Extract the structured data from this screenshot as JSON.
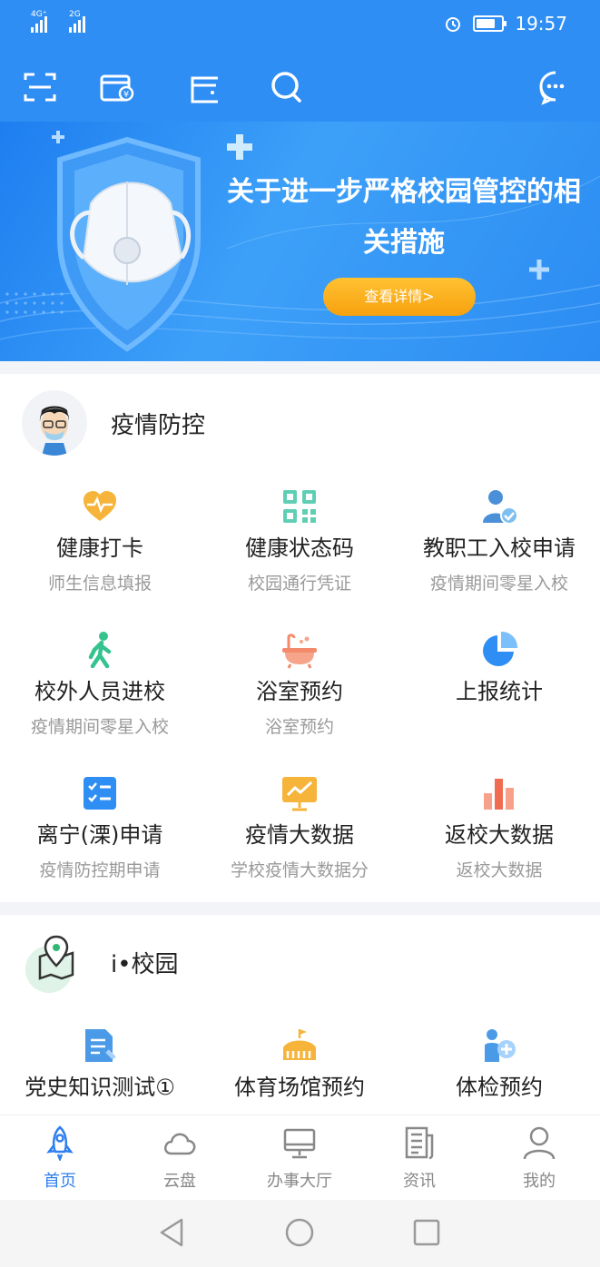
{
  "status": {
    "signal1": "4G⁺",
    "signal2": "2G",
    "time": "19:57",
    "battery_level": 0.75
  },
  "toolbar": {
    "icons": [
      "scan-icon",
      "wallet-icon",
      "card-icon",
      "search-icon",
      "message-icon"
    ]
  },
  "banner": {
    "title": "关于进一步严格校园管控的相关措施",
    "button": "查看详情>"
  },
  "epidemic": {
    "title": "疫情防控",
    "items": [
      {
        "label": "健康打卡",
        "sub": "师生信息填报",
        "icon": "heart-pulse-icon"
      },
      {
        "label": "健康状态码",
        "sub": "校园通行凭证",
        "icon": "qr-code-icon"
      },
      {
        "label": "教职工入校申请",
        "sub": "疫情期间零星入校",
        "icon": "staff-check-icon"
      },
      {
        "label": "校外人员进校",
        "sub": "疫情期间零星入校",
        "icon": "walking-person-icon"
      },
      {
        "label": "浴室预约",
        "sub": "浴室预约",
        "icon": "bathtub-icon"
      },
      {
        "label": "上报统计",
        "sub": "",
        "icon": "pie-chart-icon"
      },
      {
        "label": "离宁(溧)申请",
        "sub": "疫情防控期申请",
        "icon": "checklist-icon"
      },
      {
        "label": "疫情大数据",
        "sub": "学校疫情大数据分",
        "icon": "trend-board-icon"
      },
      {
        "label": "返校大数据",
        "sub": "返校大数据",
        "icon": "bar-chart-icon"
      }
    ]
  },
  "campus": {
    "title": "i•校园",
    "items": [
      {
        "label": "党史知识测试①",
        "icon": "document-edit-icon"
      },
      {
        "label": "体育场馆预约",
        "icon": "stadium-icon"
      },
      {
        "label": "体检预约",
        "icon": "medical-person-icon"
      }
    ]
  },
  "tabs": [
    {
      "label": "首页",
      "icon": "rocket-icon",
      "active": true
    },
    {
      "label": "云盘",
      "icon": "cloud-icon",
      "active": false
    },
    {
      "label": "办事大厅",
      "icon": "monitor-icon",
      "active": false
    },
    {
      "label": "资讯",
      "icon": "news-icon",
      "active": false
    },
    {
      "label": "我的",
      "icon": "user-icon",
      "active": false
    }
  ],
  "colors": {
    "primary": "#2f8ef4",
    "accent_orange": "#f7a10e",
    "tab_active": "#2f7ff0"
  }
}
